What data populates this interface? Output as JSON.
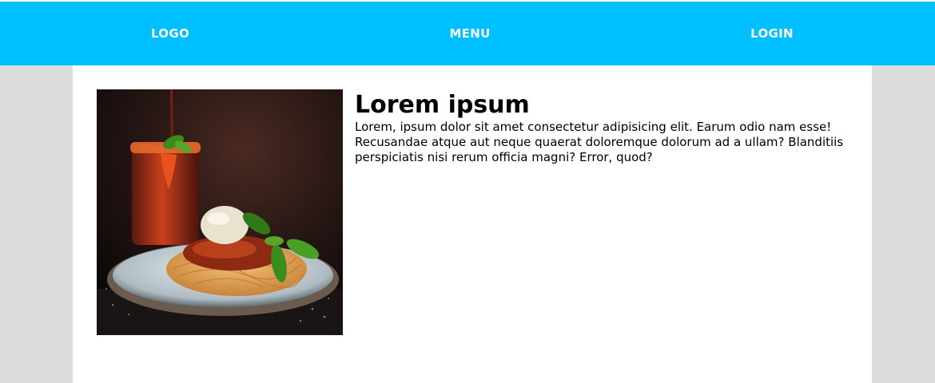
{
  "navbar": {
    "logo_label": "LOGO",
    "menu_label": "MENU",
    "login_label": "LOGIN",
    "background_color": "#00bfff"
  },
  "article": {
    "title": "Lorem ipsum",
    "body": "Lorem, ipsum dolor sit amet consectetur adipisicing elit. Earum odio nam esse! Recusandae atque aut neque quaerat doloremque dolorum ad a ullam? Blanditiis perspiciatis nisi rerum officia magni? Error, quod?",
    "image_subject": "spaghetti with tomato sauce, basil and a glass of tomato juice"
  },
  "colors": {
    "page_background": "#dcdcdc",
    "content_background": "#ffffff",
    "nav_text": "#ffffff"
  }
}
